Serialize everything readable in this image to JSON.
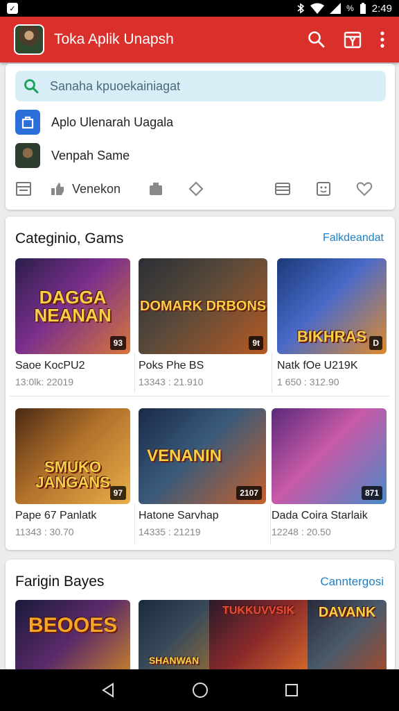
{
  "status_bar": {
    "time": "2:49",
    "battery_text": "%"
  },
  "app_bar": {
    "title": "Toka Aplik Unapsh"
  },
  "search": {
    "placeholder": "Sanaha kpuoekainiagat"
  },
  "suggestions": [
    {
      "label": "Aplo Ulenarah Uagala",
      "icon": "store-bag-icon"
    },
    {
      "label": "Venpah Same",
      "icon": "game-thumb-icon"
    }
  ],
  "toolbar": {
    "chip_label": "Venekon"
  },
  "categories_section": {
    "title": "Categinio, Gams",
    "link": "Falkdeandat",
    "games": [
      {
        "overlay": "DAGGA NEANAN",
        "count": "93",
        "name": "Saoe KocPU2",
        "meta": "13:0lk: 22019",
        "bg": "linear-gradient(135deg,#2b1e4a,#7a2f8c 45%,#d8763a)"
      },
      {
        "overlay": "DOMARK DRBONS",
        "count": "9t",
        "name": "Poks Phe BS",
        "meta": "13343 : 21.910",
        "bg": "linear-gradient(135deg,#2a2f35,#5a4a3a 45%,#b85a22)"
      },
      {
        "overlay": "BIKHRAS",
        "count": "D",
        "name": "Natk fOe U219K",
        "meta": "1 650 : 312.90",
        "bg": "linear-gradient(135deg,#1a3a7a,#4a6ac8 45%,#e08a2a)"
      },
      {
        "overlay": "SMUKO JANGANS",
        "count": "97",
        "name": "Pape 67 Panlatk",
        "meta": "11343 : 30.70",
        "bg": "linear-gradient(135deg,#4a2a14,#b0702a 45%,#e8b04a)"
      },
      {
        "overlay": "VENANIN",
        "count": "2107",
        "name": "Hatone Sarvhap",
        "meta": "14335 : 21219",
        "bg": "linear-gradient(135deg,#1a2a4a,#3a5a7a 45%,#c8602a)"
      },
      {
        "overlay": "",
        "count": "871",
        "name": "Dada Coira Starlaik",
        "meta": "12248 : 20.50",
        "bg": "linear-gradient(135deg,#5a2a7a,#c85aa8 45%,#4a8ac8)"
      }
    ]
  },
  "featured_section": {
    "title": "Farigin Bayes",
    "link": "Canntergosi",
    "games": [
      {
        "overlay": "BEOOES",
        "bg": "linear-gradient(135deg,#1a1a3a,#5a2a6a 50%,#c8802a)"
      },
      {
        "overlay": "SHANWAN",
        "bg": "linear-gradient(135deg,#1a2a3a,#3a4a5a 50%,#8a6a3a)"
      },
      {
        "overlay": "TUKKUVVSIK",
        "bg": "linear-gradient(135deg,#2a1a2a,#8a2a2a 50%,#d86a2a)"
      },
      {
        "overlay": "DAVANK",
        "bg": "linear-gradient(135deg,#2a2a3a,#4a5a6a 50%,#a84a2a)"
      }
    ]
  },
  "colors": {
    "app_bar": "#d9302c",
    "accent_link": "#1f7fc4",
    "search_bg": "#d7eef7"
  }
}
